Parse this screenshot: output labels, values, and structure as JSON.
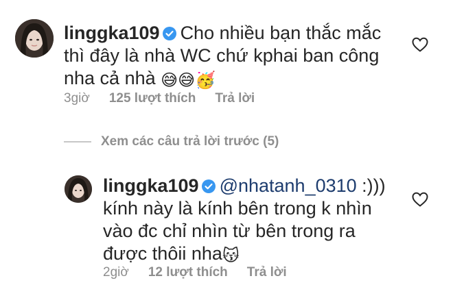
{
  "comment1": {
    "username": "linggka109",
    "text_line1": "Cho nhiều bạn thắc mắc",
    "text_line2": "thì đây là nhà WC chứ kphai ban công",
    "text_line3": "nha cả nhà",
    "emojis": "😅😅🥳",
    "time": "3giờ",
    "likes": "125 lượt thích",
    "reply": "Trả lời"
  },
  "view_replies": "Xem các câu trả lời trước (5)",
  "comment2": {
    "username": "linggka109",
    "mention": "@nhatanh_0310",
    "text_line1_rest": " :)))",
    "text_line2": "kính này là kính bên trong k nhìn",
    "text_line3": "vào đc chỉ nhìn từ bên trong ra",
    "text_line4": "được thôii nha",
    "emoji": "😽",
    "time": "2giờ",
    "likes": "12 lượt thích",
    "reply": "Trả lời"
  },
  "colors": {
    "text": "#262626",
    "meta": "#8e8e8e",
    "verified": "#3897f0",
    "mention": "#1d3c6e"
  },
  "icons": [
    "verified-badge-icon",
    "heart-icon",
    "avatar"
  ]
}
